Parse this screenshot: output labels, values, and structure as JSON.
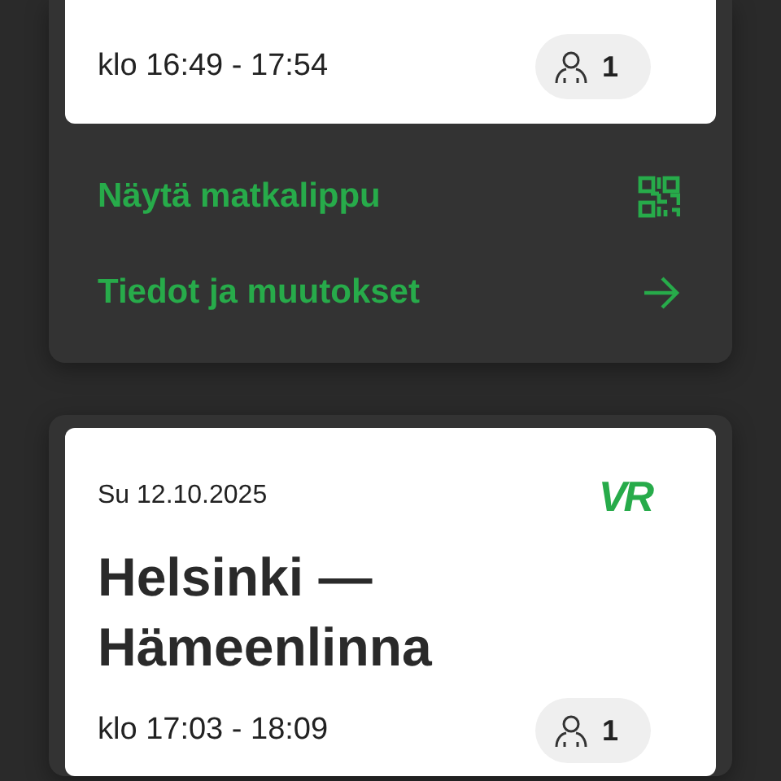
{
  "trips": [
    {
      "time": "klo 16:49 - 17:54",
      "passengers": "1",
      "actions": [
        {
          "kind": "ticket",
          "label": "Näytä matkalippu"
        },
        {
          "kind": "details",
          "label": "Tiedot ja muutokset"
        }
      ]
    },
    {
      "date": "Su 12.10.2025",
      "logo": "VR",
      "title": "Helsinki — Hämeenlinna",
      "time": "klo 17:03 - 18:09",
      "passengers": "1"
    }
  ]
}
